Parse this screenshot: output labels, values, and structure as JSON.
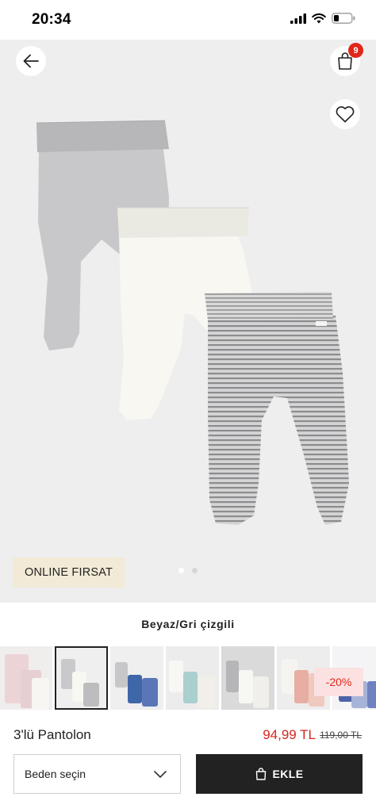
{
  "status_bar": {
    "time": "20:34"
  },
  "header": {
    "cart_count": "9"
  },
  "hero": {
    "deal_tag": "ONLINE FIRSAT",
    "image_count": 2,
    "current_image": 1
  },
  "variant": {
    "color_name": "Beyaz/Gri çizgili",
    "swatch_count": 7,
    "selected_swatch": 2,
    "discount_badge": "-20%"
  },
  "product": {
    "title": "3'lü Pantolon",
    "price": "94,99 TL",
    "old_price": "119,00 TL"
  },
  "actions": {
    "size_label": "Beden seçin",
    "add_label": "EKLE"
  },
  "colors": {
    "accent_red": "#e0251b",
    "price_red": "#d4261c",
    "button_dark": "#222222",
    "deal_tag_bg": "#f2ead6"
  },
  "icons": [
    "back-arrow-icon",
    "shopping-bag-icon",
    "heart-icon",
    "chevron-down-icon",
    "bag-icon",
    "signal-icon",
    "wifi-icon",
    "battery-icon"
  ]
}
